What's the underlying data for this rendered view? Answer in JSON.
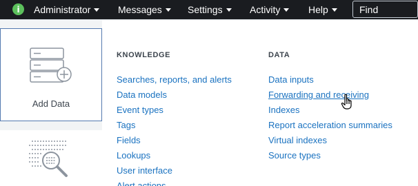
{
  "navbar": {
    "info_badge": "i",
    "items": [
      {
        "label": "Administrator"
      },
      {
        "label": "Messages"
      },
      {
        "label": "Settings"
      },
      {
        "label": "Activity"
      },
      {
        "label": "Help"
      }
    ],
    "find_placeholder": "Find"
  },
  "dropdown": {
    "add_data_tile": {
      "label": "Add Data",
      "icon": "server-add-icon"
    },
    "search_tile": {
      "icon": "search-logs-icon"
    },
    "knowledge": {
      "header": "KNOWLEDGE",
      "links": [
        "Searches, reports, and alerts",
        "Data models",
        "Event types",
        "Tags",
        "Fields",
        "Lookups",
        "User interface",
        "Alert actions"
      ]
    },
    "data": {
      "header": "DATA",
      "links": [
        "Data inputs",
        "Forwarding and receiving",
        "Indexes",
        "Report acceleration summaries",
        "Virtual indexes",
        "Source types"
      ],
      "hovered": "Forwarding and receiving"
    }
  },
  "colors": {
    "navbar_bg": "#1a1c20",
    "link": "#1a72c0",
    "badge_green": "#5cc05c",
    "tile_border": "#5379af"
  }
}
